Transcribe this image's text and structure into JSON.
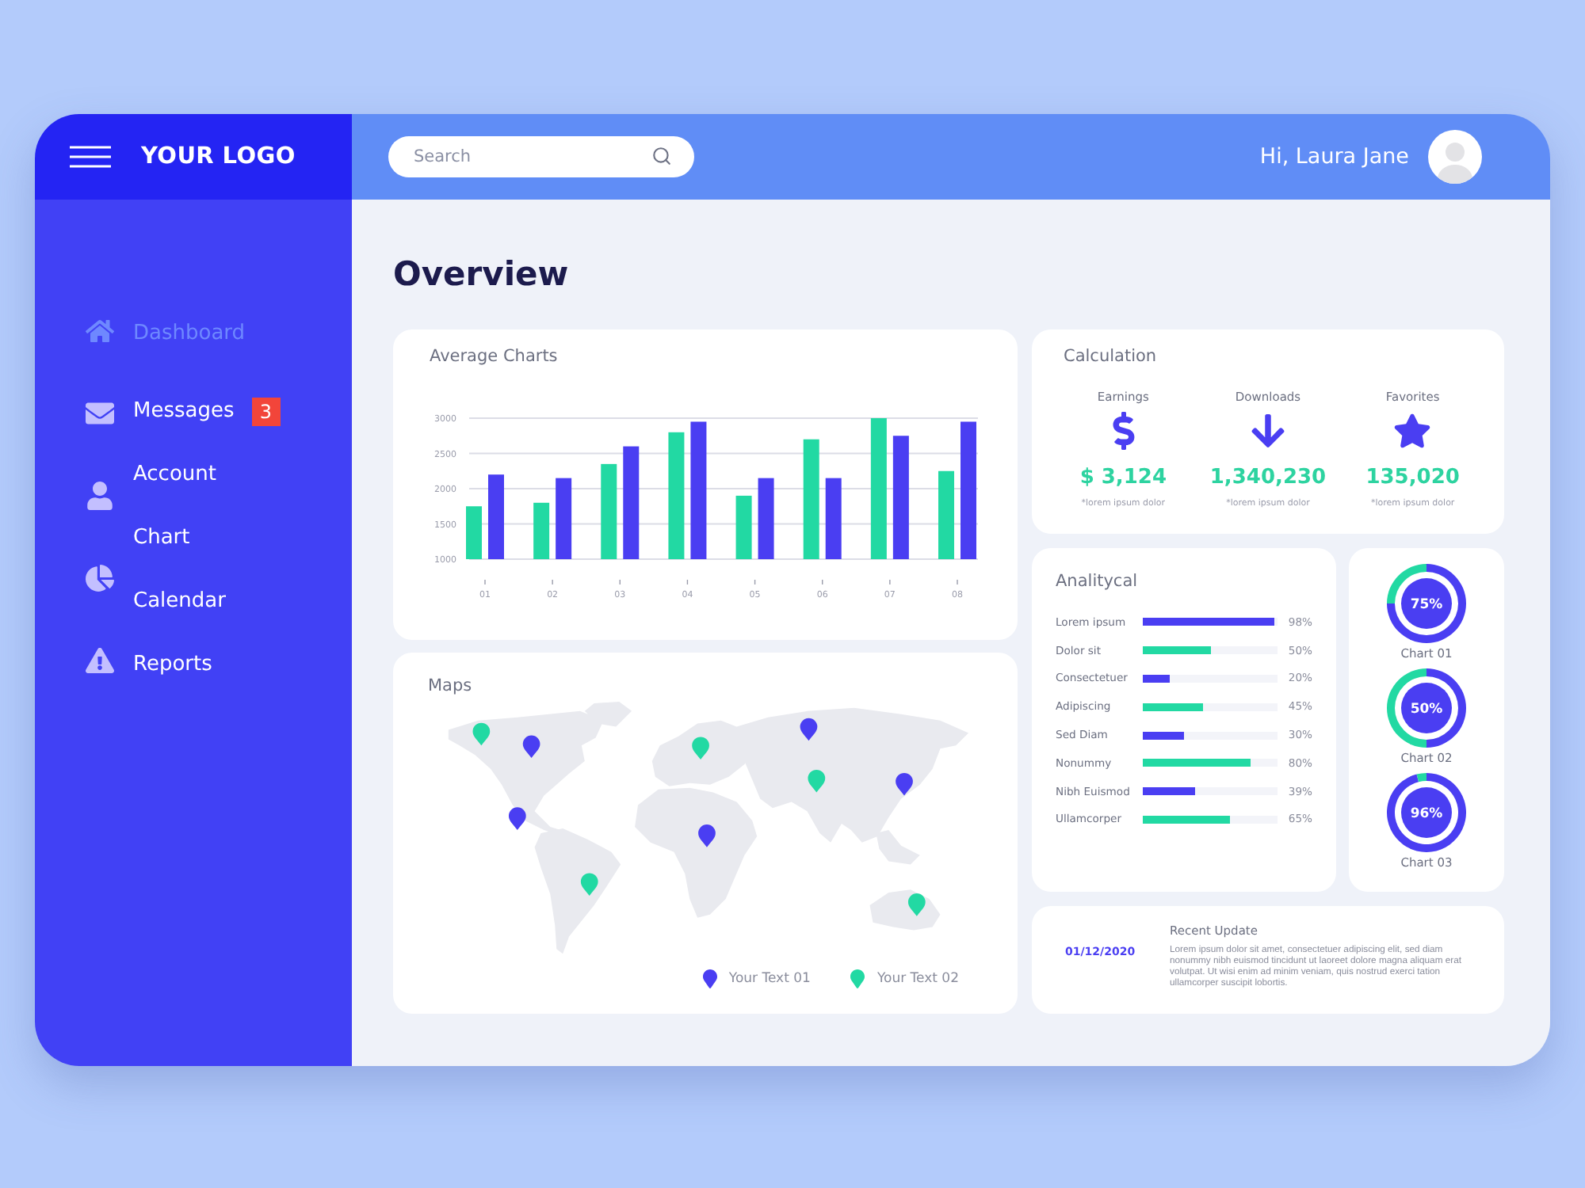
{
  "header": {
    "logo": "YOUR LOGO",
    "search": {
      "placeholder": "Search"
    },
    "greeting": "Hi, Laura Jane"
  },
  "sidebar": {
    "items": [
      {
        "label": "Dashboard",
        "kind": "home",
        "selected": true
      },
      {
        "label": "Messages",
        "kind": "mail",
        "selected": false,
        "badge": "3"
      },
      {
        "label": "Account",
        "kind": "user",
        "selected": false
      },
      {
        "label": "Chart",
        "kind": "pie",
        "selected": false
      },
      {
        "label": "Calendar",
        "kind": "plain",
        "selected": false
      },
      {
        "label": "Reports",
        "kind": "alert",
        "selected": false
      }
    ]
  },
  "page_title": "Overview",
  "average_charts": {
    "chart_data": {
      "type": "bar",
      "title": "Average Charts",
      "categories": [
        "01",
        "02",
        "03",
        "04",
        "05",
        "06",
        "07",
        "08"
      ],
      "series": [
        {
          "color": "#22d9a3",
          "values": [
            1750,
            1800,
            2350,
            2800,
            1900,
            2700,
            3000,
            2250
          ]
        },
        {
          "color": "#4a3ef2",
          "values": [
            2200,
            2150,
            2600,
            2950,
            2150,
            2150,
            2750,
            2950
          ]
        }
      ],
      "ylim": [
        1000,
        3000
      ],
      "yticks": [
        1000,
        1500,
        2000,
        2500,
        3000
      ],
      "grid": true
    }
  },
  "maps": {
    "title": "Maps",
    "pins": [
      {
        "color": "#4a3ef2"
      },
      {
        "color": "#22d9a3"
      },
      {
        "color": "#4a3ef2"
      },
      {
        "color": "#22d9a3"
      },
      {
        "color": "#22d9a3"
      },
      {
        "color": "#4a3ef2"
      },
      {
        "color": "#4a3ef2"
      },
      {
        "color": "#4a3ef2"
      },
      {
        "color": "#22d9a3"
      },
      {
        "color": "#22d9a3"
      }
    ],
    "legend": [
      {
        "label": "Your Text 01",
        "color": "#4a3ef2"
      },
      {
        "label": "Your Text 02",
        "color": "#22d9a3"
      }
    ]
  },
  "calculation": {
    "title": "Calculation",
    "stats": [
      {
        "kind": "dollar",
        "label": "Earnings",
        "value": "$ 3,124",
        "note": "*lorem ipsum dolor"
      },
      {
        "kind": "download",
        "label": "Downloads",
        "value": "1,340,230",
        "note": "*lorem ipsum dolor"
      },
      {
        "kind": "star",
        "label": "Favorites",
        "value": "135,020",
        "note": "*lorem ipsum dolor"
      }
    ]
  },
  "analytical": {
    "title": "Analitycal",
    "rows": [
      {
        "label": "Lorem ipsum",
        "level": 0.98,
        "reading": "98%",
        "color": "#4a3ef2"
      },
      {
        "label": "Dolor sit",
        "level": 0.5,
        "reading": "50%",
        "color": "#22d9a3"
      },
      {
        "label": "Consectetuer",
        "level": 0.2,
        "reading": "20%",
        "color": "#4a3ef2"
      },
      {
        "label": "Adipiscing",
        "level": 0.45,
        "reading": "45%",
        "color": "#22d9a3"
      },
      {
        "label": "Sed Diam",
        "level": 0.3,
        "reading": "30%",
        "color": "#4a3ef2"
      },
      {
        "label": "Nonummy",
        "level": 0.8,
        "reading": "80%",
        "color": "#22d9a3"
      },
      {
        "label": "Nibh Euismod",
        "level": 0.39,
        "reading": "39%",
        "color": "#4a3ef2"
      },
      {
        "label": "Ullamcorper",
        "level": 0.65,
        "reading": "65%",
        "color": "#22d9a3"
      }
    ]
  },
  "donuts": [
    {
      "value": "75%",
      "label": "Chart 01",
      "chart_data": {
        "type": "donut",
        "values": [
          75,
          25
        ]
      }
    },
    {
      "value": "50%",
      "label": "Chart 02",
      "chart_data": {
        "type": "donut",
        "values": [
          50,
          50
        ]
      }
    },
    {
      "value": "96%",
      "label": "Chart 03",
      "chart_data": {
        "type": "donut",
        "values": [
          96,
          4
        ]
      }
    }
  ],
  "recent_update": {
    "date": "01/12/2020",
    "title": "Recent Update",
    "text": "Lorem ipsum dolor sit amet, consectetuer adipiscing elit, sed diam nonummy nibh euismod tincidunt ut laoreet dolore magna aliquam erat volutpat. Ut wisi enim ad minim veniam, quis nostrud exerci tation ullamcorper suscipit lobortis."
  }
}
